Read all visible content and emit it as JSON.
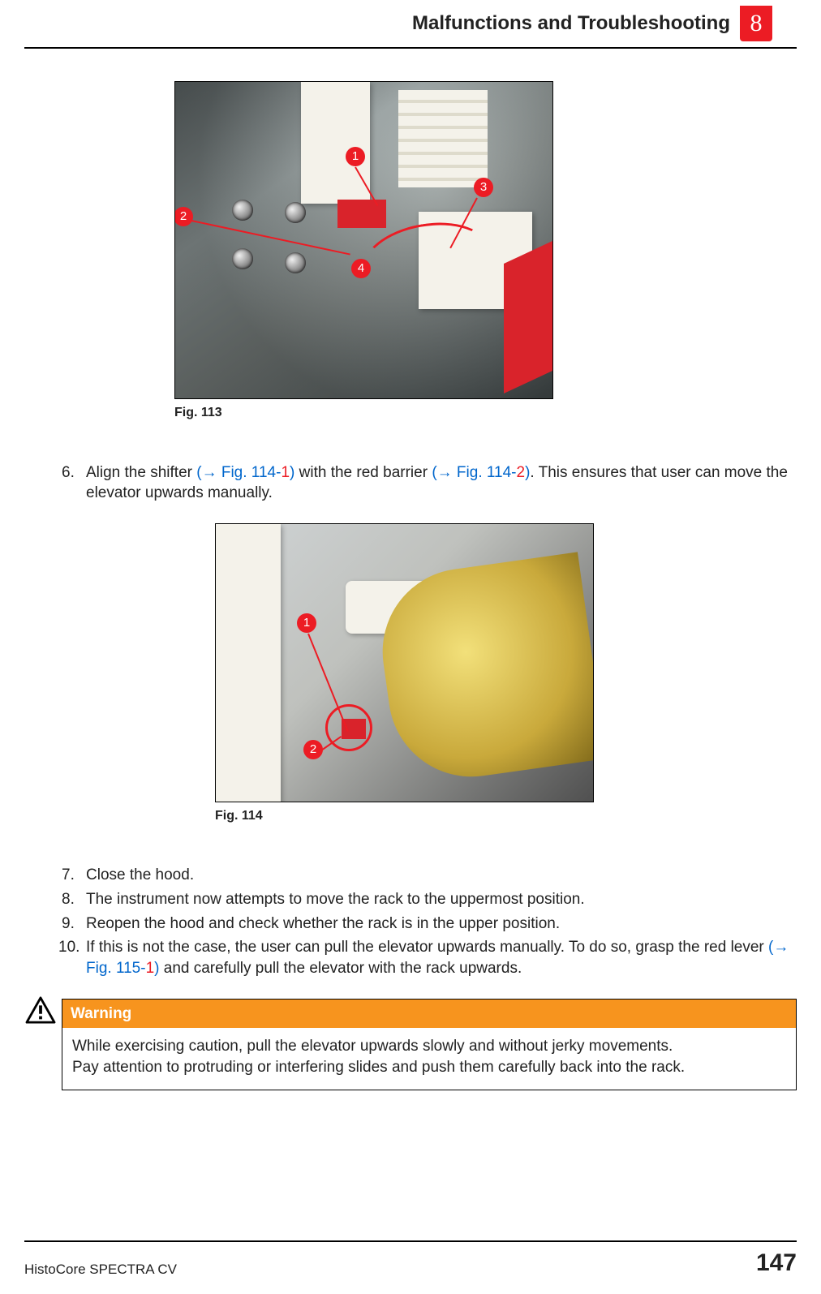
{
  "header": {
    "title": "Malfunctions and Troubleshooting",
    "chapter": "8"
  },
  "figures": {
    "fig113": {
      "caption": "Fig.  113",
      "callouts": {
        "c1": "1",
        "c2": "2",
        "c3": "3",
        "c4": "4"
      }
    },
    "fig114": {
      "caption": "Fig.  114",
      "callouts": {
        "c1": "1",
        "c2": "2"
      }
    }
  },
  "steps": {
    "s6": {
      "num": "6.",
      "pre": "Align the shifter ",
      "ref1_open": "(→ Fig.  114-",
      "ref1_num": "1",
      "ref1_close": ")",
      "mid": " with the red barrier ",
      "ref2_open": "(→ Fig.  114-",
      "ref2_num": "2",
      "ref2_close": ")",
      "post": ". This ensures that user can move the elevator upwards manually."
    },
    "s7": {
      "num": "7.",
      "text": "Close the hood."
    },
    "s8": {
      "num": "8.",
      "text": "The instrument now attempts to move the rack to the uppermost position."
    },
    "s9": {
      "num": "9.",
      "text": "Reopen the hood and check whether the rack is in the upper position."
    },
    "s10": {
      "num": "10.",
      "pre": "If this is not the case, the user can pull the elevator upwards manually. To do so, grasp the red lever ",
      "ref_open": "(→ Fig.  115-",
      "ref_num": "1",
      "ref_close": ")",
      "post": " and carefully pull the elevator with the rack upwards."
    }
  },
  "warning": {
    "label": "Warning",
    "line1": "While exercising caution, pull the elevator upwards slowly and without jerky movements.",
    "line2": "Pay attention to protruding or interfering slides and push them carefully back into the rack."
  },
  "footer": {
    "product": "HistoCore SPECTRA CV",
    "page": "147"
  }
}
